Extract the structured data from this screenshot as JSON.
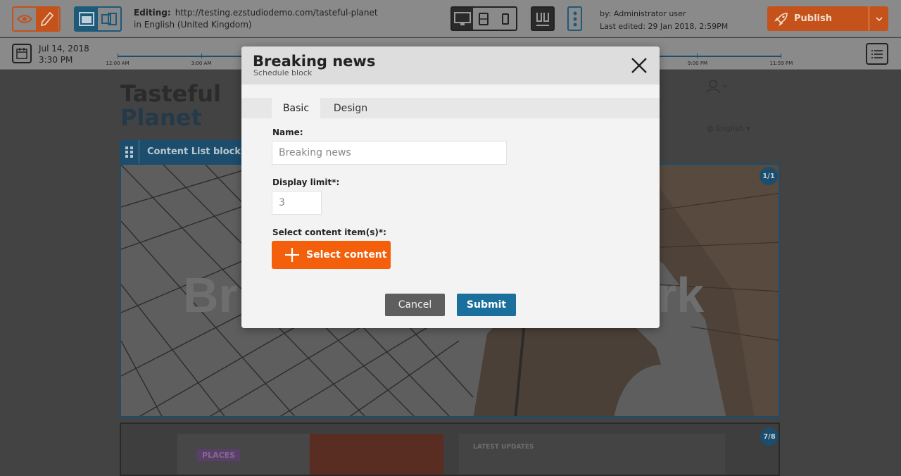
{
  "toolbar": {
    "editing_label": "Editing:",
    "editing_url": "http://testing.ezstudiodemo.com/tasteful-planet",
    "editing_language": "in English (United Kingdom)",
    "author": "by: Administrator user",
    "last_edited": "Last edited: 29 Jan 2018, 2:59PM",
    "publish_label": "Publish",
    "accent_color": "#f35f0a",
    "primary_color": "#1a6f9c"
  },
  "timeline": {
    "date": "Jul 14, 2018",
    "time": "3:30 PM",
    "ticks": [
      "12:00 AM",
      "3:00 AM",
      "9:00 PM",
      "11:59 PM"
    ]
  },
  "page": {
    "site_title_1": "Tasteful",
    "site_title_2": "Planet",
    "language": "English",
    "block_label": "Content List block",
    "hero_text_left": "Br",
    "hero_text_right": "rk",
    "badge_top": "1/1",
    "badge_bottom": "7/8",
    "places_tag": "PLACES",
    "latest_updates": "LATEST UPDATES"
  },
  "modal": {
    "title": "Breaking news",
    "subtitle": "Schedule block",
    "tabs": [
      "Basic",
      "Design"
    ],
    "active_tab": "Basic",
    "name_label": "Name:",
    "name_value": "Breaking news",
    "display_limit_label": "Display limit*:",
    "display_limit_value": "3",
    "select_label": "Select content item(s)*:",
    "select_button": "Select content",
    "cancel": "Cancel",
    "submit": "Submit"
  }
}
